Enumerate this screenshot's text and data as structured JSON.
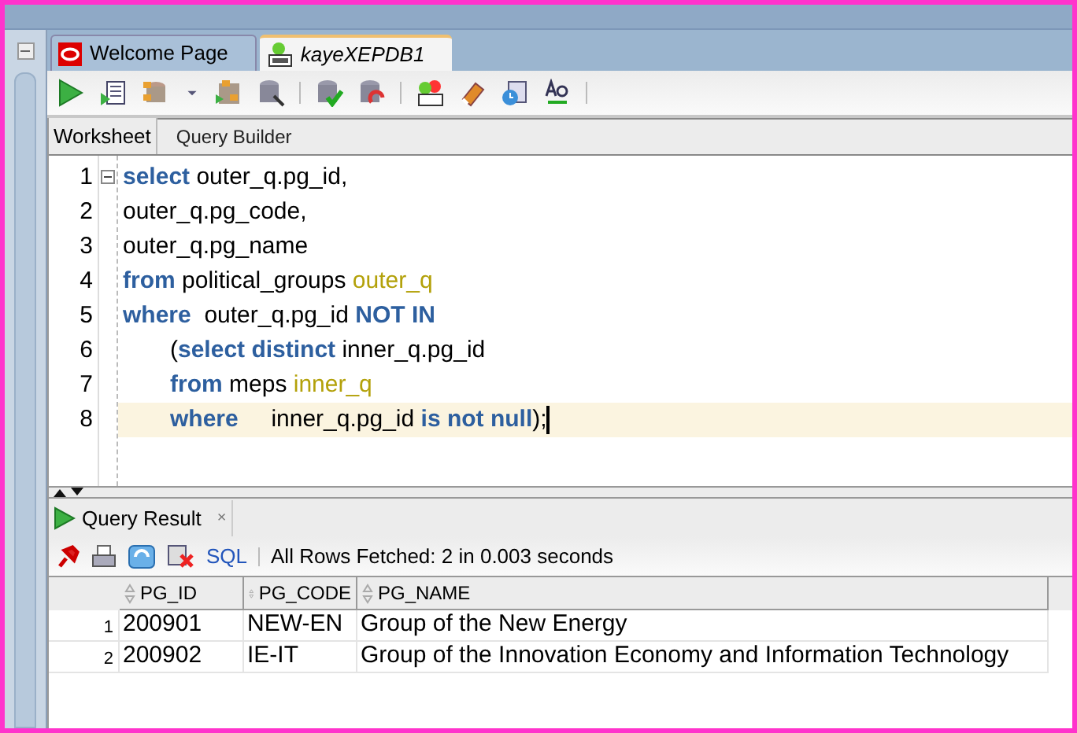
{
  "editor_tabs": [
    {
      "label": "Welcome Page",
      "selected": false,
      "kind": "welcome"
    },
    {
      "label": "kayeXEPDB1",
      "selected": true,
      "kind": "sql"
    }
  ],
  "worksheet_tabs": [
    {
      "label": "Worksheet",
      "selected": true
    },
    {
      "label": "Query Builder",
      "selected": false
    }
  ],
  "code_lines": [
    {
      "number": "1",
      "current": false,
      "tokens": [
        {
          "text": "select",
          "kind": "keyword"
        },
        {
          "text": " outer_q.pg_id,",
          "kind": "plain"
        }
      ]
    },
    {
      "number": "2",
      "current": false,
      "tokens": [
        {
          "text": "outer_q.pg_code,",
          "kind": "plain"
        }
      ]
    },
    {
      "number": "3",
      "current": false,
      "tokens": [
        {
          "text": "outer_q.pg_name",
          "kind": "plain"
        }
      ]
    },
    {
      "number": "4",
      "current": false,
      "tokens": [
        {
          "text": "from",
          "kind": "keyword"
        },
        {
          "text": " political_groups ",
          "kind": "plain"
        },
        {
          "text": "outer_q",
          "kind": "alias"
        }
      ]
    },
    {
      "number": "5",
      "current": false,
      "tokens": [
        {
          "text": "where",
          "kind": "keyword"
        },
        {
          "text": "  outer_q.pg_id ",
          "kind": "plain"
        },
        {
          "text": "NOT IN",
          "kind": "keyword"
        }
      ]
    },
    {
      "number": "6",
      "current": false,
      "indented": true,
      "tokens": [
        {
          "text": "(",
          "kind": "plain"
        },
        {
          "text": "select distinct",
          "kind": "keyword"
        },
        {
          "text": " inner_q.pg_id",
          "kind": "plain"
        }
      ]
    },
    {
      "number": "7",
      "current": false,
      "indented": true,
      "tokens": [
        {
          "text": "from",
          "kind": "keyword"
        },
        {
          "text": " meps ",
          "kind": "plain"
        },
        {
          "text": "inner_q",
          "kind": "alias"
        }
      ]
    },
    {
      "number": "8",
      "current": true,
      "indented": true,
      "tokens": [
        {
          "text": "where",
          "kind": "keyword"
        },
        {
          "text": "     inner_q.pg_id ",
          "kind": "plain"
        },
        {
          "text": "is not null",
          "kind": "keyword"
        },
        {
          "text": ");",
          "kind": "plain"
        }
      ]
    }
  ],
  "result_tab": {
    "label": "Query Result",
    "close": "×"
  },
  "result_toolbar": {
    "sql_link": "SQL",
    "status": "All Rows Fetched: 2 in 0.003 seconds"
  },
  "table": {
    "columns": [
      "PG_ID",
      "PG_CODE",
      "PG_NAME"
    ],
    "rows": [
      {
        "number": "1",
        "cells": [
          "200901",
          "NEW-EN",
          "Group of the New Energy"
        ]
      },
      {
        "number": "2",
        "cells": [
          "200902",
          "IE-IT",
          "Group of the Innovation Economy and Information Technology"
        ]
      }
    ]
  }
}
